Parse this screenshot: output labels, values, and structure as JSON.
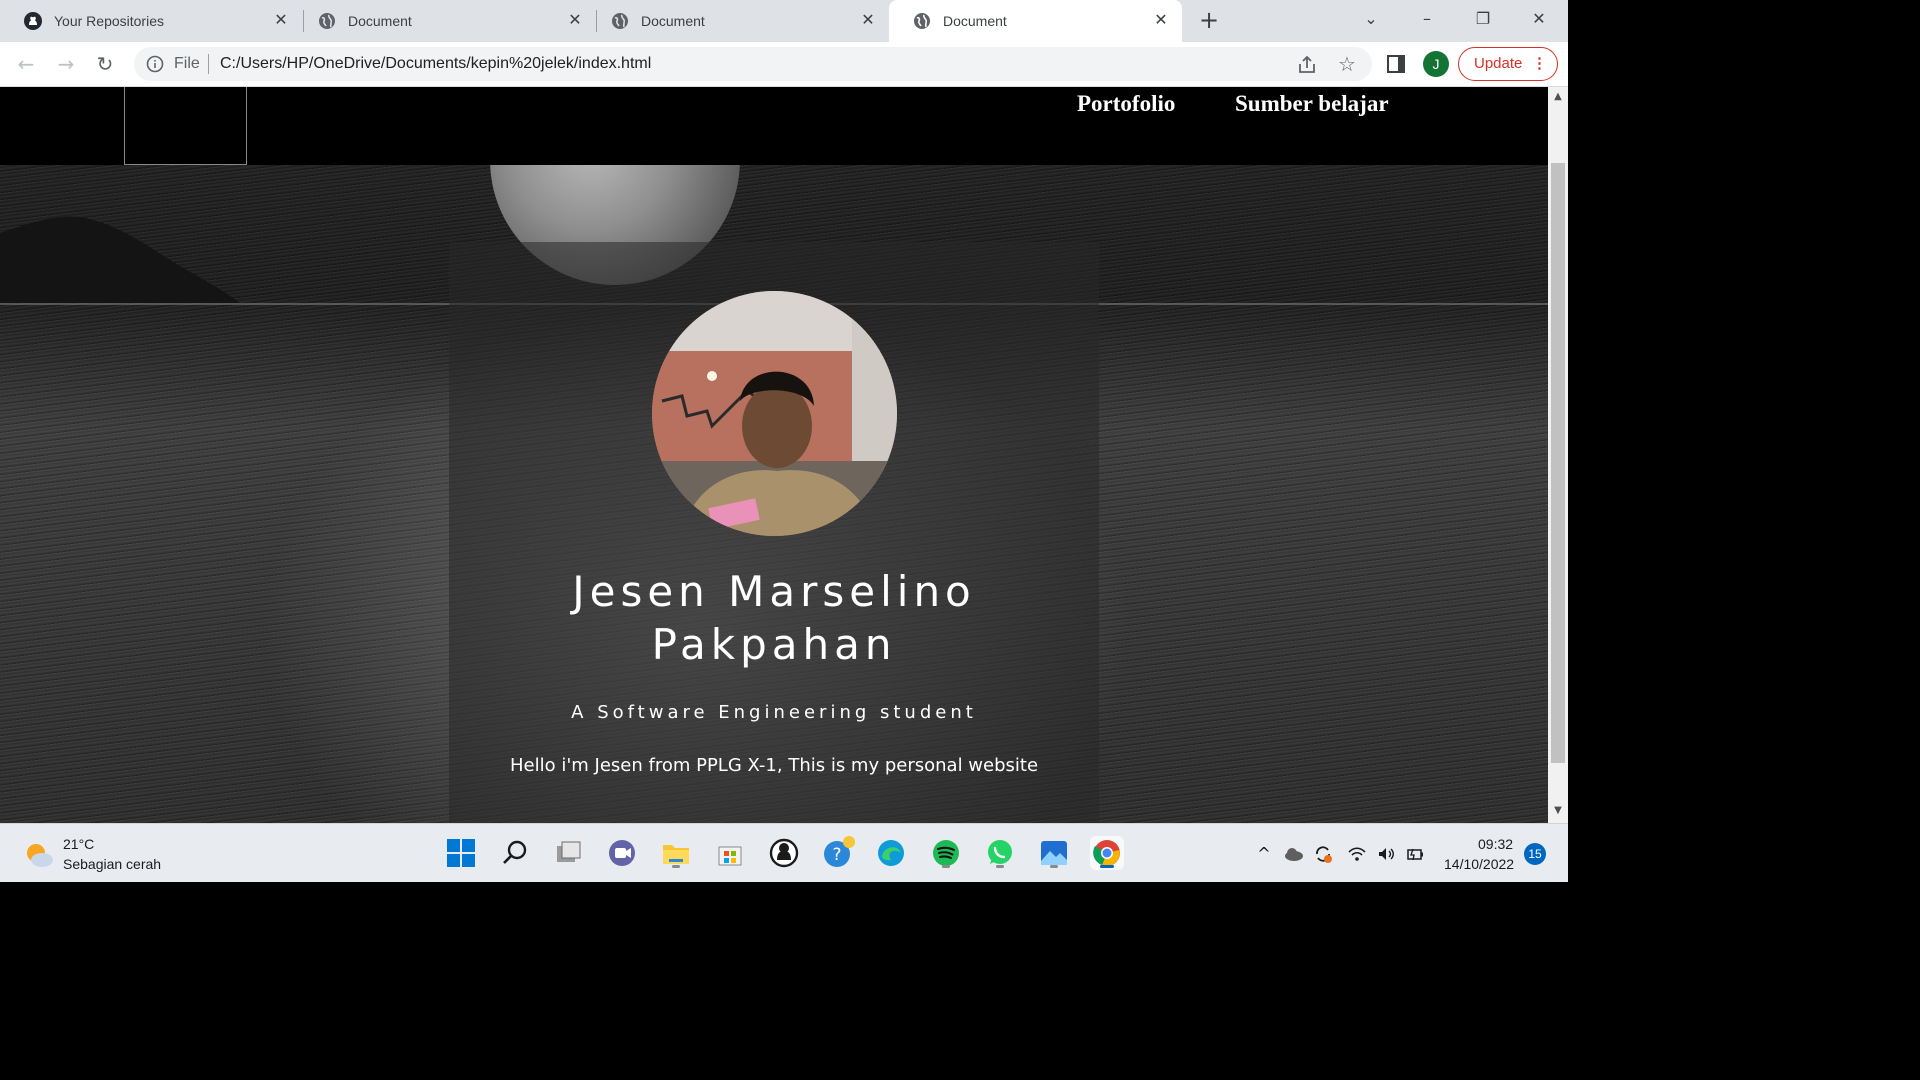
{
  "browser": {
    "tabs": [
      {
        "title": "Your Repositories",
        "icon": "github-icon",
        "active": false
      },
      {
        "title": "Document",
        "icon": "globe-icon",
        "active": false
      },
      {
        "title": "Document",
        "icon": "globe-icon",
        "active": false
      },
      {
        "title": "Document",
        "icon": "globe-icon",
        "active": true
      }
    ],
    "address": {
      "scheme_label": "File",
      "url": "C:/Users/HP/OneDrive/Documents/kepin%20jelek/index.html"
    },
    "profile_initial": "J",
    "update_label": "Update"
  },
  "page": {
    "nav": {
      "links": [
        "Portofolio",
        "Sumber belajar"
      ]
    },
    "hero": {
      "name_line1": "Jesen Marselino",
      "name_line2": "Pakpahan",
      "tagline": "A Software Engineering student",
      "intro": "Hello i'm Jesen from PPLG X-1, This is my personal website"
    }
  },
  "taskbar": {
    "weather": {
      "temp": "21°C",
      "desc": "Sebagian cerah"
    },
    "apps": [
      "start-icon",
      "search-icon",
      "task-view-icon",
      "teams-chat-icon",
      "file-explorer-icon",
      "microsoft-store-icon",
      "github-desktop-icon",
      "get-help-icon",
      "edge-icon",
      "spotify-icon",
      "whatsapp-icon",
      "photos-icon",
      "chrome-icon"
    ],
    "clock": {
      "time": "09:32",
      "date": "14/10/2022"
    },
    "notifications": "15"
  },
  "colors": {
    "update_red": "#d93025",
    "profile_green": "#137333",
    "page_nav_bg": "#000000"
  }
}
